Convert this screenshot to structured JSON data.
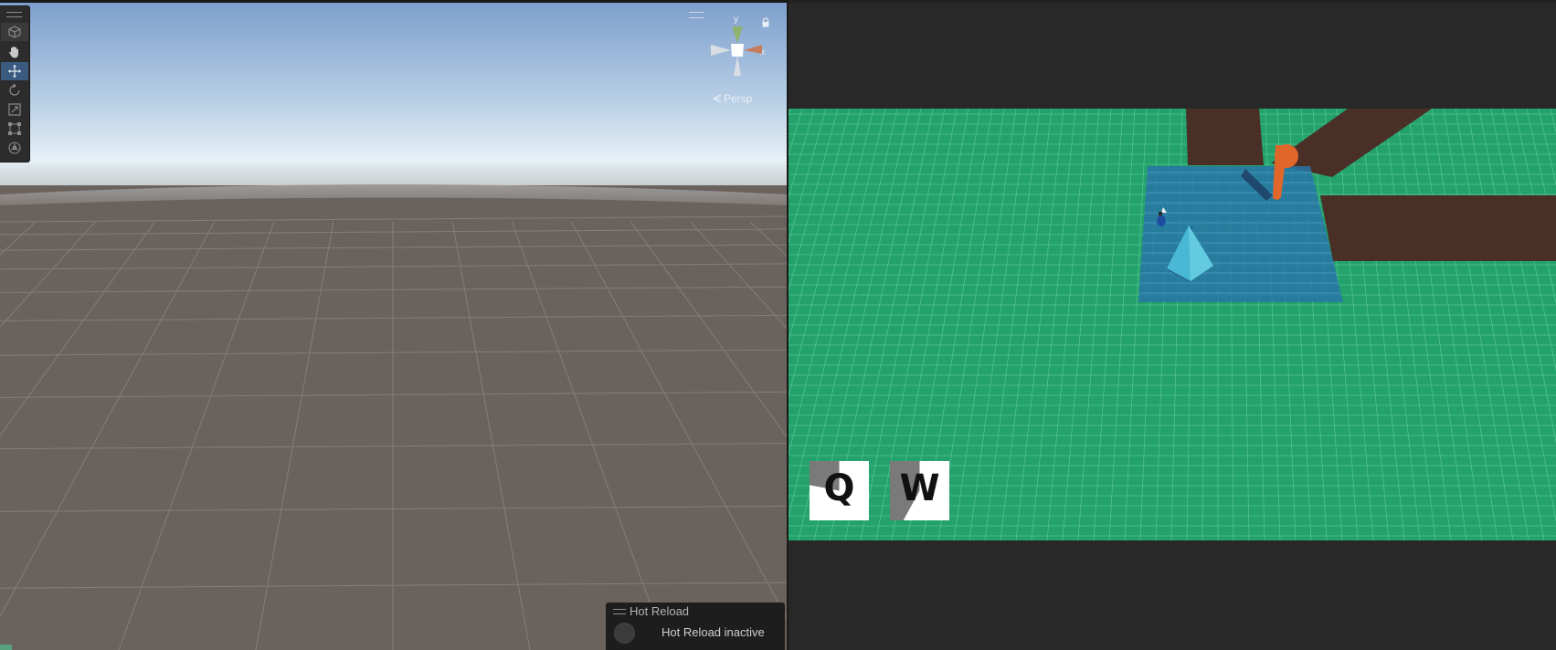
{
  "scene_view": {
    "tools": [
      {
        "id": "view",
        "icon": "cube-view-icon"
      },
      {
        "id": "hand",
        "icon": "hand-icon"
      },
      {
        "id": "move",
        "icon": "move-arrows-icon",
        "active": true
      },
      {
        "id": "rotate",
        "icon": "rotate-icon"
      },
      {
        "id": "scale",
        "icon": "scale-icon"
      },
      {
        "id": "rect",
        "icon": "rect-transform-icon"
      },
      {
        "id": "transform",
        "icon": "transform-icon"
      }
    ],
    "gizmo": {
      "y_label": "y",
      "x_label": "x",
      "colors": {
        "y": "#8fb36e",
        "x": "#c57d5f",
        "neutral": "#d8dde4"
      }
    },
    "projection_label": "Persp",
    "sky_colors": {
      "top": "#7e9fcd",
      "horizon": "#e6f0f6",
      "ground": "#6a625d"
    }
  },
  "hot_reload": {
    "title": "Hot Reload",
    "status": "Hot Reload inactive"
  },
  "game_view": {
    "ground_color": "#23a26b",
    "grid_color": "#5ec59a",
    "water_color": "#2876a6",
    "path_color": "#4a2f27",
    "character_color": "#e0662a",
    "skills": [
      {
        "key": "Q",
        "cooldown": 0.22
      },
      {
        "key": "W",
        "cooldown": 0.42
      }
    ]
  }
}
